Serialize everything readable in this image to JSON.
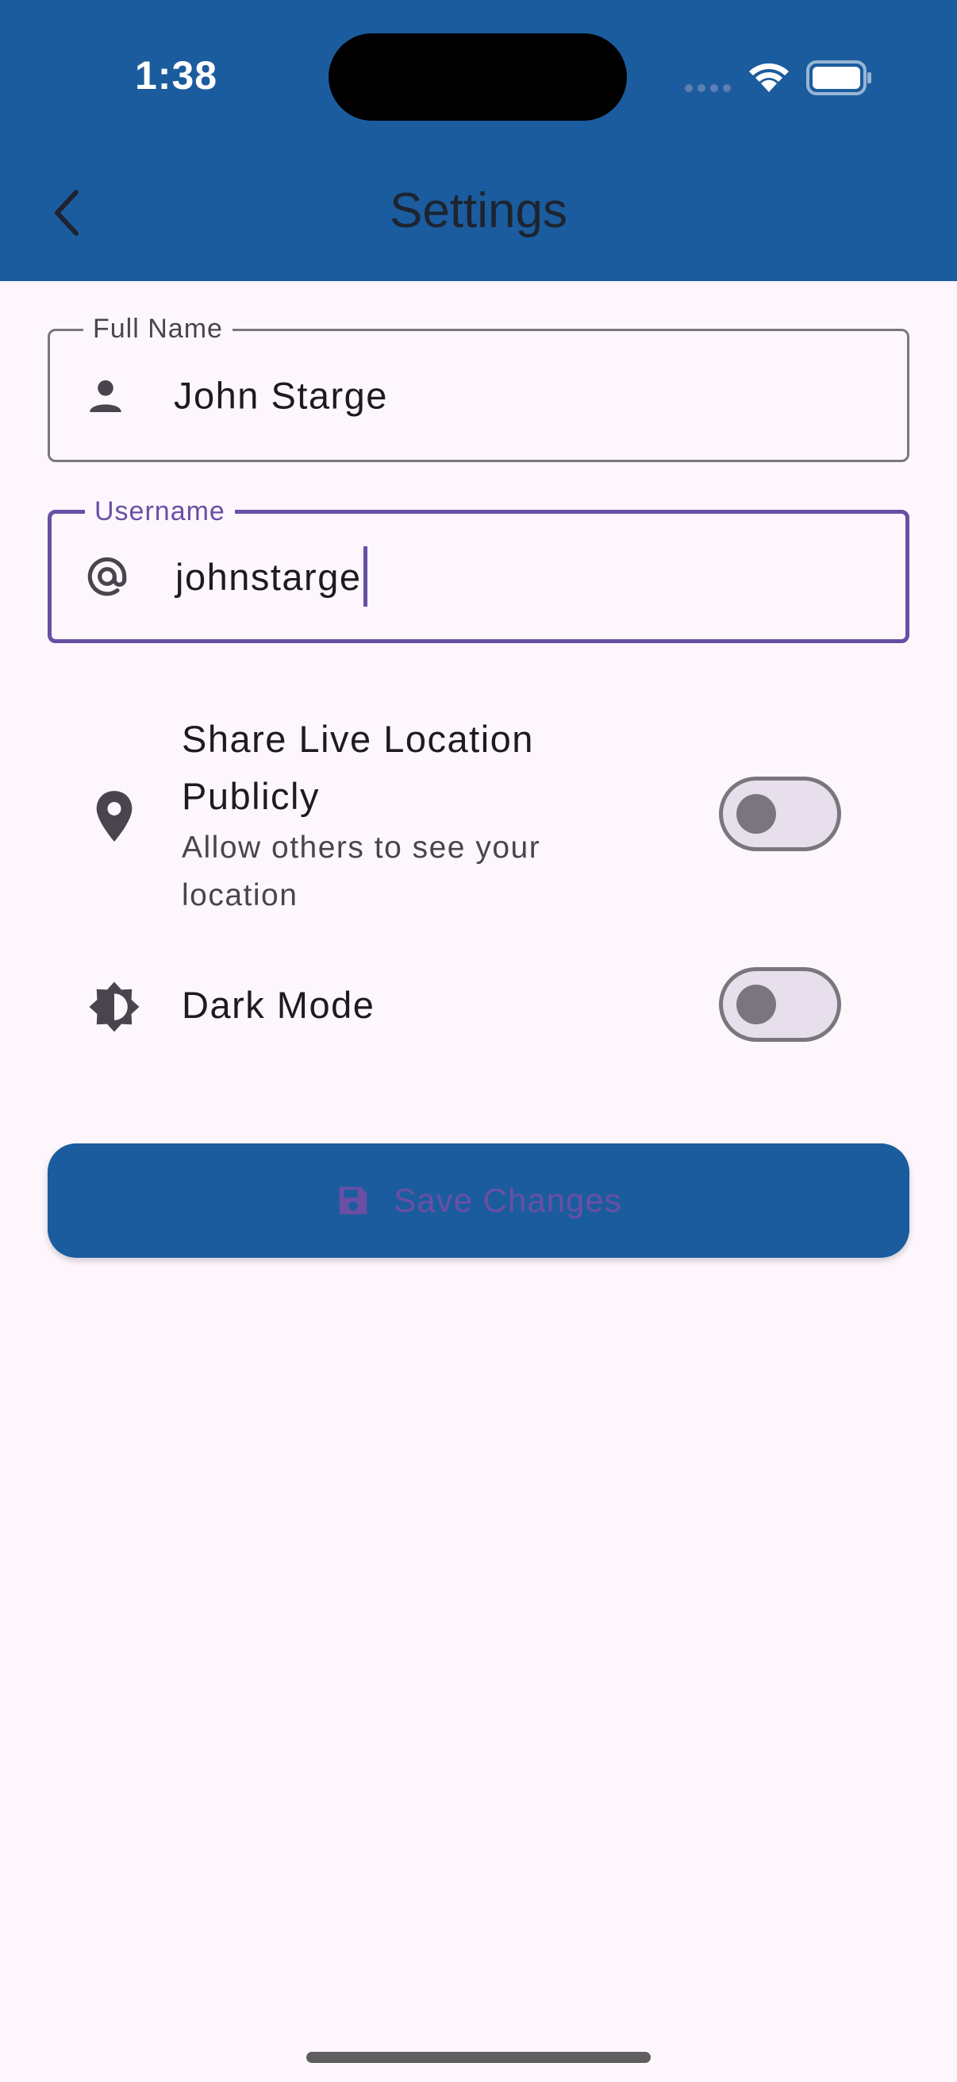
{
  "status_bar": {
    "time": "1:38"
  },
  "app_bar": {
    "title": "Settings",
    "back_icon": "chevron-left-icon",
    "color": "#1b5c9e"
  },
  "form": {
    "full_name": {
      "label": "Full Name",
      "value": "John Starge",
      "icon": "person-icon"
    },
    "username": {
      "label": "Username",
      "value": "johnstarge",
      "icon": "at-sign-icon",
      "focused": true
    }
  },
  "settings": [
    {
      "title_line1": "Share Live Location",
      "title_line2": "Publicly",
      "subtitle_line1": "Allow others to see your",
      "subtitle_line2": "location",
      "icon": "location-pin-icon",
      "enabled": false
    },
    {
      "title_line1": "Dark Mode",
      "icon": "brightness-icon",
      "enabled": false
    }
  ],
  "save_button": {
    "label": "Save Changes",
    "icon": "floppy-disk-icon"
  },
  "colors": {
    "primary": "#1b5c9e",
    "accent": "#6750a4",
    "background": "#fdf7fd"
  }
}
